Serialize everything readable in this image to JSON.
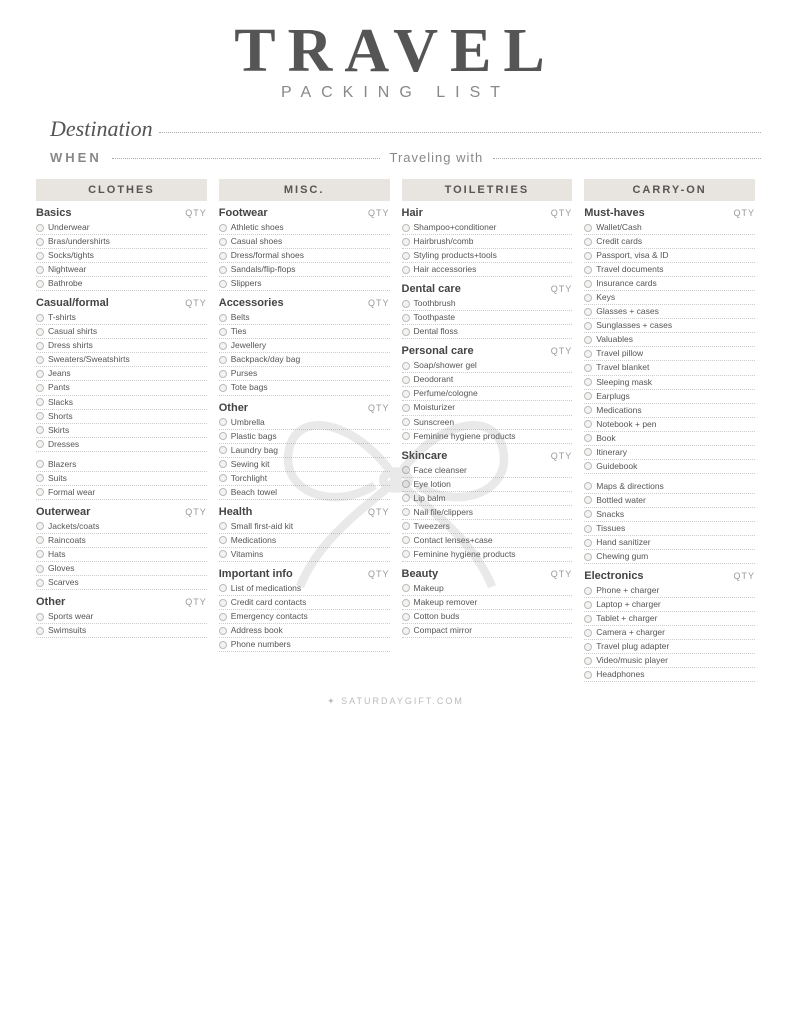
{
  "header": {
    "title": "TRAVEL",
    "subtitle": "PACKING LIST"
  },
  "destination": {
    "label": "Destination",
    "when_label": "WHEN",
    "traveling_label": "Traveling with"
  },
  "columns": {
    "clothes": {
      "header": "CLOTHES",
      "sections": [
        {
          "title": "Basics",
          "qty": "QTY",
          "items": [
            "Underwear",
            "Bras/undershirts",
            "Socks/tights",
            "Nightwear",
            "Bathrobe"
          ]
        },
        {
          "title": "Casual/formal",
          "qty": "QTY",
          "items": [
            "T-shirts",
            "Casual shirts",
            "Dress shirts",
            "Sweaters/Sweatshirts",
            "Jeans",
            "Pants",
            "Slacks",
            "Shorts",
            "Skirts",
            "Dresses"
          ]
        },
        {
          "title": "",
          "qty": "",
          "items": [
            "Blazers",
            "Suits",
            "Formal wear"
          ]
        },
        {
          "title": "Outerwear",
          "qty": "QTY",
          "items": [
            "Jackets/coats",
            "Raincoats",
            "Hats",
            "Gloves",
            "Scarves"
          ]
        },
        {
          "title": "Other",
          "qty": "QTY",
          "items": [
            "Sports wear",
            "Swimsuits"
          ]
        }
      ]
    },
    "misc": {
      "header": "MISC.",
      "sections": [
        {
          "title": "Footwear",
          "qty": "QTY",
          "items": [
            "Athletic shoes",
            "Casual shoes",
            "Dress/formal shoes",
            "Sandals/flip-flops",
            "Slippers"
          ]
        },
        {
          "title": "Accessories",
          "qty": "QTY",
          "items": [
            "Belts",
            "Ties",
            "Jewellery",
            "Backpack/day bag",
            "Purses",
            "Tote bags"
          ]
        },
        {
          "title": "Other",
          "qty": "QTY",
          "items": [
            "Umbrella",
            "Plastic bags",
            "Laundry bag",
            "Sewing kit",
            "Torchlight",
            "Beach towel"
          ]
        },
        {
          "title": "Health",
          "qty": "QTY",
          "items": [
            "Small first-aid kit",
            "Medications",
            "Vitamins"
          ]
        },
        {
          "title": "Important info",
          "qty": "QTY",
          "items": [
            "List of medications",
            "Credit card contacts",
            "Emergency contacts",
            "Address book",
            "Phone numbers"
          ]
        }
      ]
    },
    "toiletries": {
      "header": "TOILETRIES",
      "sections": [
        {
          "title": "Hair",
          "qty": "QTY",
          "items": [
            "Shampoo+conditioner",
            "Hairbrush/comb",
            "Styling products+tools",
            "Hair accessories"
          ]
        },
        {
          "title": "Dental care",
          "qty": "QTY",
          "items": [
            "Toothbrush",
            "Toothpaste",
            "Dental floss"
          ]
        },
        {
          "title": "Personal care",
          "qty": "QTY",
          "items": [
            "Soap/shower gel",
            "Deodorant",
            "Perfume/cologne",
            "Moisturizer",
            "Sunscreen",
            "Feminine hygiene products"
          ]
        },
        {
          "title": "Skincare",
          "qty": "QTY",
          "items": [
            "Face cleanser",
            "Eye lotion",
            "Lip balm",
            "Nail file/clippers",
            "Tweezers",
            "Contact lenses+case",
            "Feminine hygiene products"
          ]
        },
        {
          "title": "Beauty",
          "qty": "QTY",
          "items": [
            "Makeup",
            "Makeup remover",
            "Cotton buds",
            "Compact mirror"
          ]
        }
      ]
    },
    "carryon": {
      "header": "CARRY-ON",
      "sections": [
        {
          "title": "Must-haves",
          "qty": "QTY",
          "items": [
            "Wallet/Cash",
            "Credit cards",
            "Passport, visa & ID",
            "Travel documents",
            "Insurance cards",
            "Keys",
            "Glasses + cases",
            "Sunglasses + cases",
            "Valuables",
            "Travel pillow",
            "Travel blanket",
            "Sleeping mask",
            "Earplugs",
            "Medications",
            "Notebook + pen",
            "Book",
            "Itinerary",
            "Guidebook"
          ]
        },
        {
          "title": "",
          "qty": "",
          "items": [
            "Maps & directions",
            "Bottled water",
            "Snacks",
            "Tissues",
            "Hand sanitizer",
            "Chewing gum"
          ]
        },
        {
          "title": "Electronics",
          "qty": "QTY",
          "items": [
            "Phone + charger",
            "Laptop + charger",
            "Tablet + charger",
            "Camera + charger",
            "Travel plug adapter",
            "Video/music player",
            "Headphones"
          ]
        }
      ]
    }
  },
  "footer": {
    "text": "✦ SATURDAYGIFT.COM"
  }
}
